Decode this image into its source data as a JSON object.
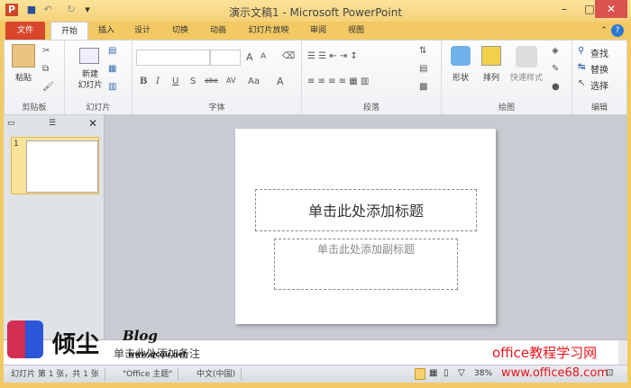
{
  "window": {
    "title": "演示文稿1 - Microsoft PowerPoint",
    "app_icon": "P",
    "minimize": "–",
    "maximize": "□",
    "close": "✕"
  },
  "quick_access": {
    "save": "save-icon",
    "undo": "↶",
    "redo": "↻",
    "customize": "▾"
  },
  "tabs": [
    {
      "label": "文件"
    },
    {
      "label": "开始"
    },
    {
      "label": "插入"
    },
    {
      "label": "设计"
    },
    {
      "label": "切换"
    },
    {
      "label": "动画"
    },
    {
      "label": "幻灯片放映"
    },
    {
      "label": "审阅"
    },
    {
      "label": "视图"
    }
  ],
  "ribbon": {
    "clipboard": {
      "label": "剪贴板",
      "paste": "粘贴"
    },
    "slides": {
      "label": "幻灯片",
      "new_slide": "新建\n幻灯片"
    },
    "font": {
      "label": "字体",
      "font_name": "",
      "font_size": "",
      "bold": "B",
      "italic": "I",
      "underline": "U",
      "shadow": "S",
      "strike": "abe",
      "spacing": "AV",
      "case": "Aa",
      "color": "A",
      "grow": "A",
      "shrink": "A"
    },
    "paragraph": {
      "label": "段落"
    },
    "drawing": {
      "label": "绘图",
      "shapes": "形状",
      "arrange": "排列",
      "quick_styles": "快速样式"
    },
    "editing": {
      "label": "编辑",
      "find": "查找",
      "replace": "替换",
      "select": "选择"
    }
  },
  "slide": {
    "title_placeholder": "单击此处添加标题",
    "subtitle_placeholder": "单击此处添加副标题",
    "thumb_number": "1"
  },
  "notes": {
    "placeholder": "单击此处添加备注"
  },
  "status": {
    "slide_info": "幻灯片 第 1 张，共 1 张",
    "theme": "\"Office 主题\"",
    "language": "中文(中国)",
    "zoom": "38%"
  },
  "watermarks": {
    "left_logo": "倾尘 Blog www.qcqu.net",
    "right_text": "office教程学习网",
    "right_url": "www.office68.com"
  }
}
